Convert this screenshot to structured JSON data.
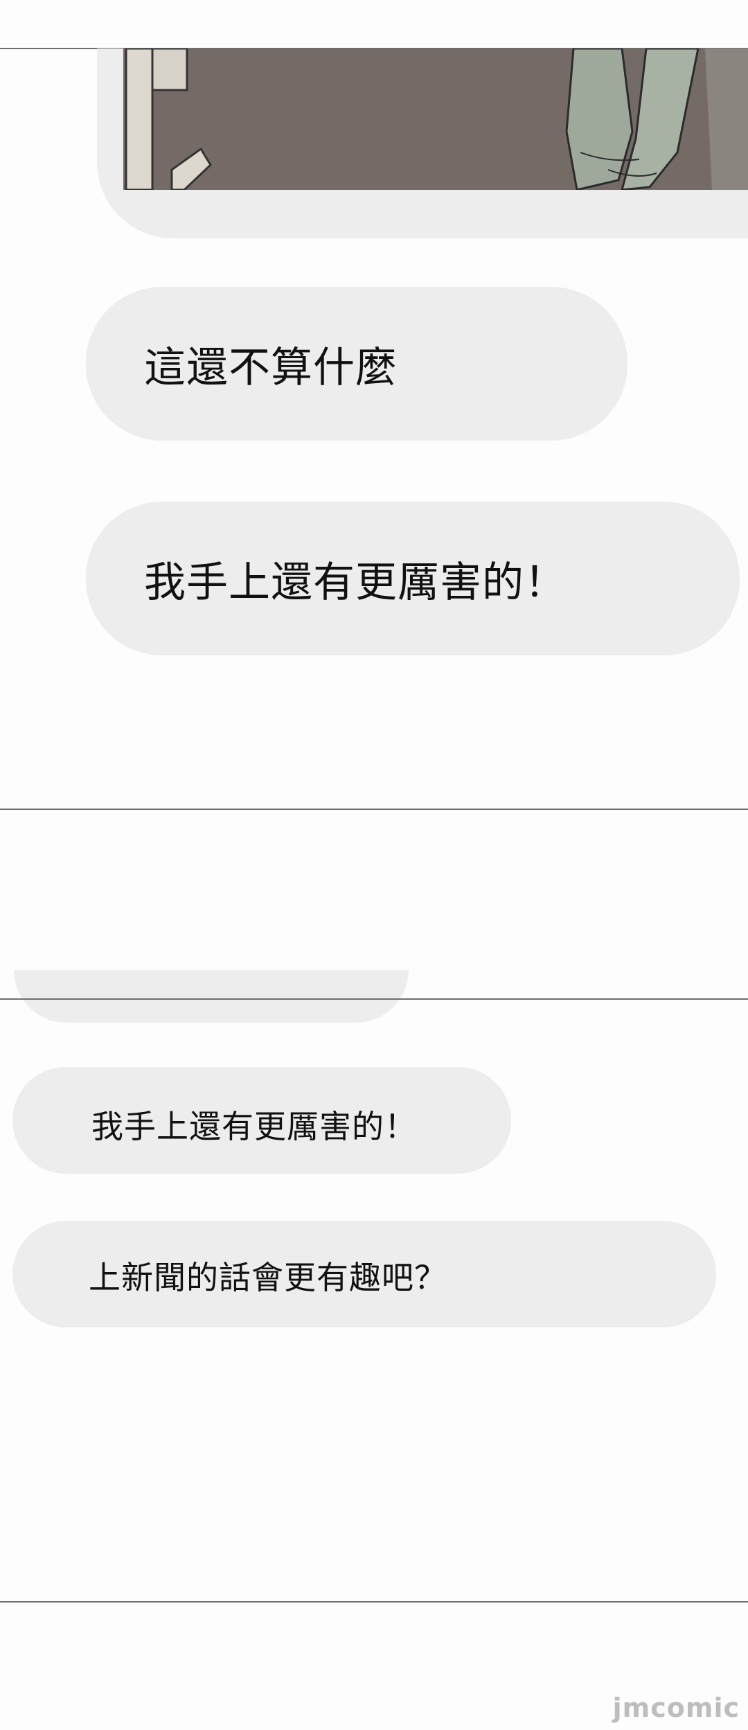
{
  "panel1": {
    "bubble_1": "這還不算什麼",
    "bubble_2": "我手上還有更厲害的！"
  },
  "panel2": {
    "bubble_1": "我手上還有更厲害的！",
    "bubble_2": "上新聞的話會更有趣吧？"
  },
  "watermark": "jmcomic"
}
